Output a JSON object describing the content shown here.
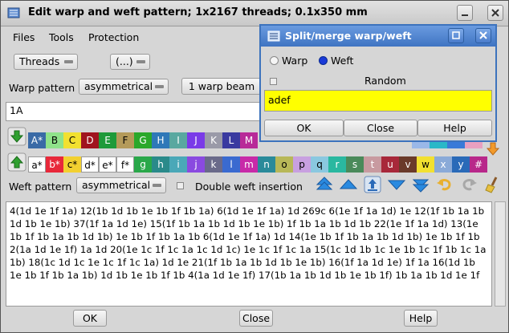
{
  "window": {
    "title": "Edit warp and weft pattern; 1x2167 threads; 0.1x350 mm"
  },
  "menu": [
    "Files",
    "Tools",
    "Protection"
  ],
  "toolbar": {
    "threads_label": "Threads",
    "more_label": "(...)"
  },
  "warp": {
    "label": "Warp pattern",
    "mode": "asymmetrical",
    "beam_button": "1 warp beam",
    "pattern_value": "1A"
  },
  "palette": {
    "top": [
      {
        "t": "A*",
        "c": "#3a6aa6",
        "fg": "#ffffff"
      },
      {
        "t": "B",
        "c": "#8fe28a",
        "fg": "#000000"
      },
      {
        "t": "C",
        "c": "#f2e030",
        "fg": "#000000"
      },
      {
        "t": "D",
        "c": "#a0141e",
        "fg": "#ffffff"
      },
      {
        "t": "E",
        "c": "#1e9a3a",
        "fg": "#ffffff"
      },
      {
        "t": "F",
        "c": "#b49a5a",
        "fg": "#000000"
      },
      {
        "t": "G",
        "c": "#2aa82a",
        "fg": "#ffffff"
      },
      {
        "t": "H",
        "c": "#2f78b8",
        "fg": "#ffffff"
      },
      {
        "t": "I",
        "c": "#59a8a0",
        "fg": "#ffffff"
      },
      {
        "t": "J",
        "c": "#7a3ae8",
        "fg": "#ffffff"
      },
      {
        "t": "K",
        "c": "#9a9aa8",
        "fg": "#ffffff"
      },
      {
        "t": "L",
        "c": "#3a3aa0",
        "fg": "#ffffff"
      },
      {
        "t": "M",
        "c": "#b82a98",
        "fg": "#ffffff"
      }
    ],
    "bottom": [
      {
        "t": "a*",
        "c": "#ffffff",
        "fg": "#000000"
      },
      {
        "t": "b*",
        "c": "#e8283a",
        "fg": "#ffffff"
      },
      {
        "t": "c*",
        "c": "#f2d030",
        "fg": "#000000"
      },
      {
        "t": "d*",
        "c": "#ffffff",
        "fg": "#000000"
      },
      {
        "t": "e*",
        "c": "#ffffff",
        "fg": "#000000"
      },
      {
        "t": "f*",
        "c": "#ffffff",
        "fg": "#000000"
      },
      {
        "t": "g",
        "c": "#2aa84a",
        "fg": "#ffffff"
      },
      {
        "t": "h",
        "c": "#2a8a8a",
        "fg": "#ffffff"
      },
      {
        "t": "i",
        "c": "#4aa8b8",
        "fg": "#ffffff"
      },
      {
        "t": "j",
        "c": "#8a4ae0",
        "fg": "#ffffff"
      },
      {
        "t": "k",
        "c": "#6a6a8a",
        "fg": "#ffffff"
      },
      {
        "t": "l",
        "c": "#3a6ad0",
        "fg": "#ffffff"
      },
      {
        "t": "m",
        "c": "#c82aa8",
        "fg": "#ffffff"
      },
      {
        "t": "n",
        "c": "#2a8a9a",
        "fg": "#ffffff"
      },
      {
        "t": "o",
        "c": "#b8b858",
        "fg": "#000000"
      },
      {
        "t": "p",
        "c": "#c8a0e0",
        "fg": "#000000"
      },
      {
        "t": "q",
        "c": "#8ac8e0",
        "fg": "#000000"
      },
      {
        "t": "r",
        "c": "#2ab8a0",
        "fg": "#ffffff"
      },
      {
        "t": "s",
        "c": "#4a8a5a",
        "fg": "#ffffff"
      },
      {
        "t": "t",
        "c": "#c89aa0",
        "fg": "#ffffff"
      },
      {
        "t": "u",
        "c": "#a8283a",
        "fg": "#ffffff"
      },
      {
        "t": "v",
        "c": "#6a3a2a",
        "fg": "#ffffff"
      },
      {
        "t": "w",
        "c": "#f2e030",
        "fg": "#000000"
      },
      {
        "t": "x",
        "c": "#8aaad8",
        "fg": "#ffffff"
      },
      {
        "t": "y",
        "c": "#2a6ab8",
        "fg": "#ffffff"
      },
      {
        "t": "#",
        "c": "#b8288a",
        "fg": "#ffffff"
      }
    ],
    "top_right": [
      {
        "c": "#9ab8e8"
      },
      {
        "c": "#2ab8c8"
      },
      {
        "c": "#3a7ad8"
      },
      {
        "c": "#e8a0c0"
      }
    ]
  },
  "weft": {
    "label": "Weft pattern",
    "mode": "asymmetrical",
    "double_label": "Double weft insertion",
    "text": "4(1d 1e 1f 1a) 12(1b 1d 1b 1e 1b 1f 1b 1a) 6(1d 1e 1f 1a) 1d 269c 6(1e 1f 1a 1d) 1e 12(1f 1b 1a 1b 1d 1b 1e 1b) 37(1f 1a 1d 1e) 15(1f 1b 1a 1b 1d 1b 1e 1b) 1f 1b 1a 1b 1d 1b 22(1e 1f 1a 1d) 13(1e 1b 1f 1b 1a 1b 1d 1b) 1e 1b 1f 1b 1a 1b 6(1d 1e 1f 1a) 1d 14(1e 1b 1f 1b 1a 1b 1d 1b) 1e 1b 1f 1b 2(1a 1d 1e 1f) 1a 1d 20(1e 1c 1f 1c 1a 1c 1d 1c) 1e 1c 1f 1c 1a 15(1c 1d 1b 1c 1e 1b 1c 1f 1b 1c 1a 1b) 18(1c 1d 1c 1e 1c 1f 1c 1a) 1d 1e 21(1f 1b 1a 1b 1d 1b 1e 1b) 16(1f 1a 1d 1e) 1f 1a 16(1d 1b 1e 1b 1f 1b 1a 1b) 1d 1b 1e 1b 1f 1b 4(1a 1d 1e 1f) 17(1b 1a 1b 1d 1b 1e 1b 1f) 1b 1a 1b 1d 1e 1f"
  },
  "bottom_buttons": {
    "ok": "OK",
    "close": "Close",
    "help": "Help"
  },
  "dialog": {
    "title": "Split/merge warp/weft",
    "radio_warp": "Warp",
    "radio_weft": "Weft",
    "random_label": "Random",
    "input_value": "adef",
    "input_color": "#ffff00",
    "ok": "OK",
    "close": "Close",
    "help": "Help"
  }
}
